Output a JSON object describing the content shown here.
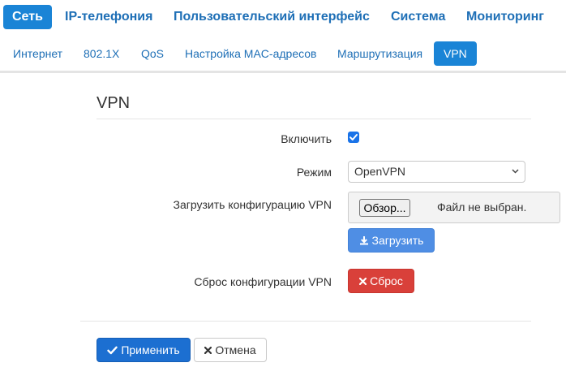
{
  "nav_main": {
    "items": [
      "Сеть",
      "IP-телефония",
      "Пользовательский интерфейс",
      "Система",
      "Мониторинг"
    ],
    "active": "Сеть"
  },
  "nav_sub": {
    "items": [
      "Интернет",
      "802.1X",
      "QoS",
      "Настройка MAC-адресов",
      "Маршрутизация",
      "VPN"
    ],
    "active": "VPN"
  },
  "section": {
    "title": "VPN"
  },
  "form": {
    "enable": {
      "label": "Включить",
      "checked": true
    },
    "mode": {
      "label": "Режим",
      "value": "OpenVPN"
    },
    "upload_config": {
      "label": "Загрузить конфигурацию VPN",
      "browse_label": "Обзор...",
      "file_status": "Файл не выбран.",
      "upload_label": "Загрузить"
    },
    "reset_config": {
      "label": "Сброс конфигурации VPN",
      "button_label": "Сброс"
    }
  },
  "footer": {
    "apply_label": "Применить",
    "cancel_label": "Отмена"
  },
  "colors": {
    "accent": "#1a84d6",
    "link": "#1e6fb6",
    "upload_button": "#4f8ee4",
    "reset_button": "#d9403a",
    "apply_button": "#1c6fd1"
  },
  "icons": {
    "upload": "download-icon",
    "reset": "close-icon",
    "apply": "check-icon",
    "cancel": "close-icon"
  }
}
